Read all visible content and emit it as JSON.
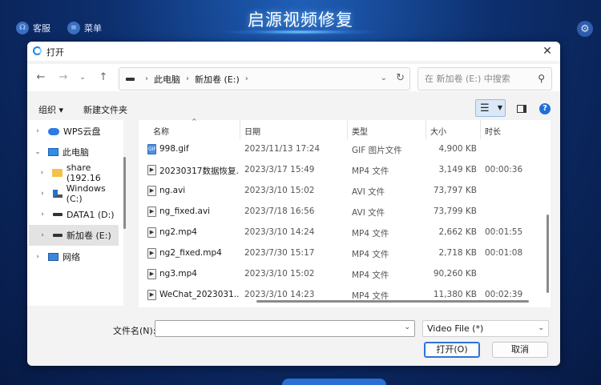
{
  "app": {
    "title": "启源视频修复",
    "support_label": "客服",
    "menu_label": "菜单"
  },
  "dialog": {
    "title": "打开",
    "breadcrumb": [
      "此电脑",
      "新加卷 (E:)"
    ],
    "search_placeholder": "在 新加卷 (E:) 中搜索",
    "toolbar": {
      "organize": "组织 ▾",
      "new_folder": "新建文件夹"
    },
    "sidebar": [
      {
        "label": "WPS云盘",
        "icon": "cloud-icon",
        "expanded": false
      },
      {
        "label": "此电脑",
        "icon": "computer-icon",
        "expanded": true
      },
      {
        "label": "share (192.16",
        "icon": "folder-icon",
        "expanded": false
      },
      {
        "label": "Windows (C:)",
        "icon": "windows-drive-icon",
        "expanded": false
      },
      {
        "label": "DATA1 (D:)",
        "icon": "drive-icon",
        "expanded": false
      },
      {
        "label": "新加卷 (E:)",
        "icon": "drive-icon",
        "expanded": false,
        "selected": true
      },
      {
        "label": "网络",
        "icon": "network-icon",
        "expanded": false
      }
    ],
    "columns": {
      "name": "名称",
      "date": "日期",
      "type": "类型",
      "size": "大小",
      "duration": "时长"
    },
    "files": [
      {
        "name": "998.gif",
        "date": "2023/11/13 17:24",
        "type": "GIF 图片文件",
        "size": "4,900 KB",
        "duration": "",
        "icon": "gif"
      },
      {
        "name": "20230317数据恢复...",
        "date": "2023/3/17 15:49",
        "type": "MP4 文件",
        "size": "3,149 KB",
        "duration": "00:00:36",
        "icon": "video"
      },
      {
        "name": "ng.avi",
        "date": "2023/3/10 15:02",
        "type": "AVI 文件",
        "size": "73,797 KB",
        "duration": "",
        "icon": "video"
      },
      {
        "name": "ng_fixed.avi",
        "date": "2023/7/18 16:56",
        "type": "AVI 文件",
        "size": "73,799 KB",
        "duration": "",
        "icon": "video"
      },
      {
        "name": "ng2.mp4",
        "date": "2023/3/10 14:24",
        "type": "MP4 文件",
        "size": "2,662 KB",
        "duration": "00:01:55",
        "icon": "video"
      },
      {
        "name": "ng2_fixed.mp4",
        "date": "2023/7/30 15:17",
        "type": "MP4 文件",
        "size": "2,718 KB",
        "duration": "00:01:08",
        "icon": "video"
      },
      {
        "name": "ng3.mp4",
        "date": "2023/3/10 15:02",
        "type": "MP4 文件",
        "size": "90,260 KB",
        "duration": "",
        "icon": "video"
      },
      {
        "name": "WeChat_2023031...",
        "date": "2023/3/10 14:23",
        "type": "MP4 文件",
        "size": "11,380 KB",
        "duration": "00:02:39",
        "icon": "video"
      }
    ],
    "filename_label": "文件名(N):",
    "filename_value": "",
    "filetype_value": "Video File (*)",
    "open_button": "打开(O)",
    "cancel_button": "取消"
  }
}
